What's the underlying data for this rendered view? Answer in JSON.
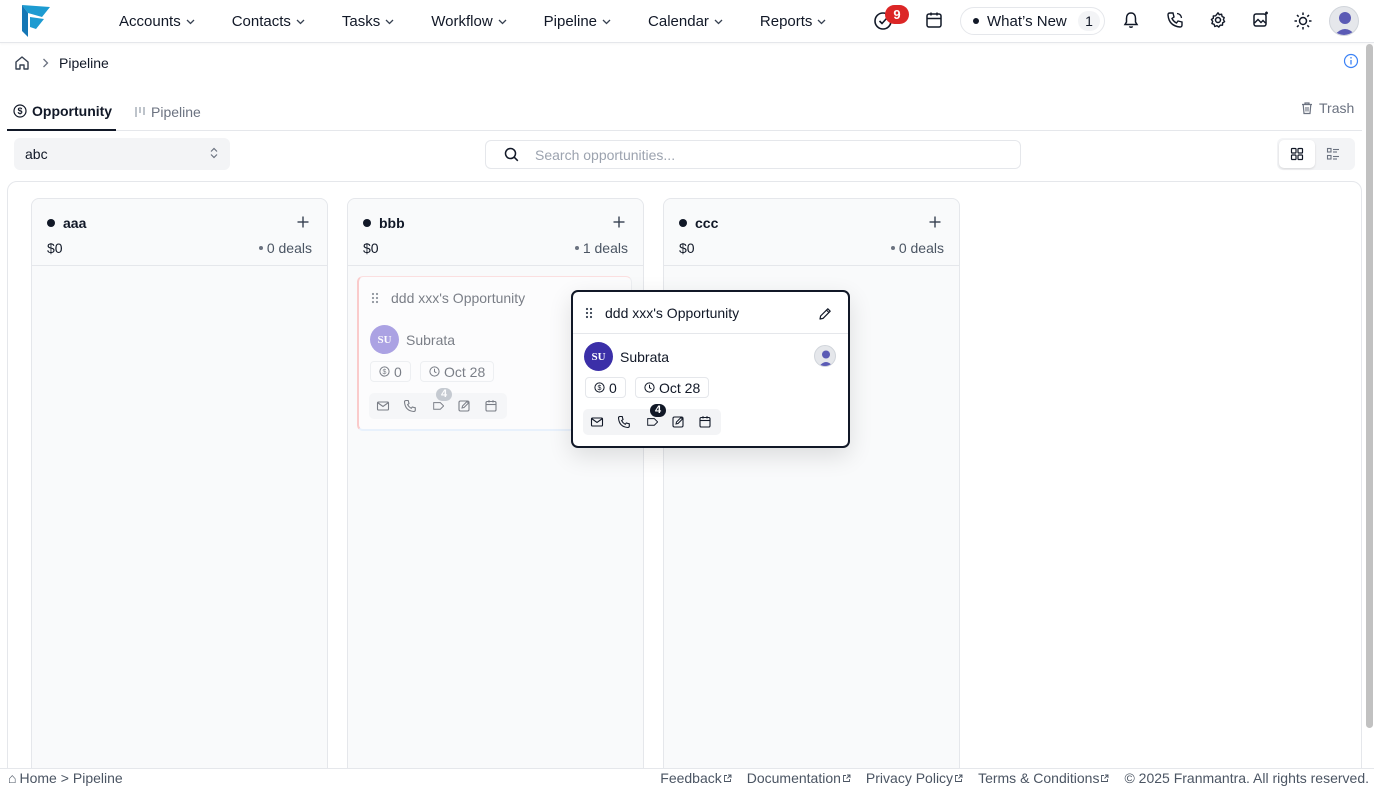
{
  "nav": {
    "items": [
      {
        "label": "Accounts"
      },
      {
        "label": "Contacts"
      },
      {
        "label": "Tasks"
      },
      {
        "label": "Workflow"
      },
      {
        "label": "Pipeline"
      },
      {
        "label": "Calendar"
      },
      {
        "label": "Reports"
      }
    ],
    "tasks_badge": "9",
    "whats_new_label": "What’s New",
    "whats_new_count": "1"
  },
  "breadcrumb": {
    "current": "Pipeline"
  },
  "tabs": [
    {
      "label": "Opportunity",
      "active": true
    },
    {
      "label": "Pipeline",
      "active": false
    }
  ],
  "trash_label": "Trash",
  "pipeline_select": {
    "value": "abc"
  },
  "search": {
    "placeholder": "Search opportunities..."
  },
  "columns": [
    {
      "name": "aaa",
      "amount": "$0",
      "deals": "0 deals"
    },
    {
      "name": "bbb",
      "amount": "$0",
      "deals": "1 deals"
    },
    {
      "name": "ccc",
      "amount": "$0",
      "deals": "0 deals"
    }
  ],
  "card": {
    "title": "ddd xxx's Opportunity",
    "owner_initials": "SU",
    "owner_name": "Subrata",
    "value": "0",
    "date": "Oct 28",
    "tag_count": "4"
  },
  "colors": {
    "accent": "#111827",
    "owner_avatar": "#3b2fa8",
    "badge": "#dc2626"
  },
  "footer": {
    "home": "Home >",
    "page": "Pipeline",
    "links": [
      "Feedback",
      "Documentation",
      "Privacy Policy",
      "Terms & Conditions"
    ],
    "copyright": "© 2025 Franmantra. All rights reserved."
  }
}
